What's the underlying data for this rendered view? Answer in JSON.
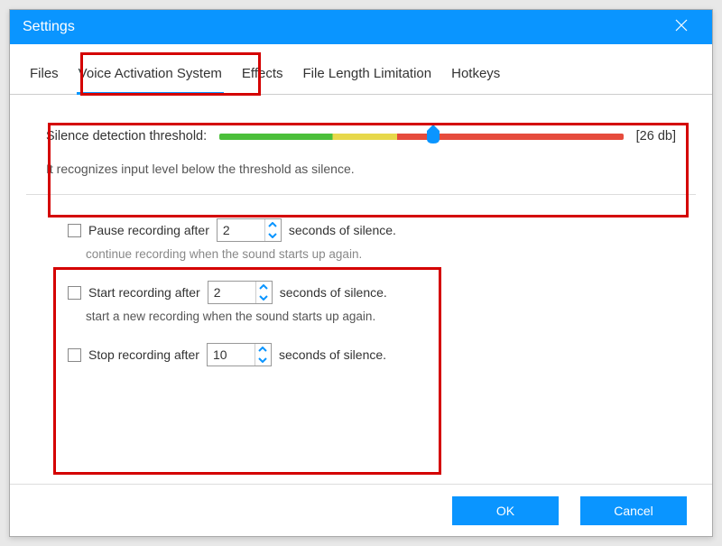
{
  "window": {
    "title": "Settings"
  },
  "tabs": {
    "items": [
      {
        "label": "Files"
      },
      {
        "label": "Voice Activation System"
      },
      {
        "label": "Effects"
      },
      {
        "label": "File Length Limitation"
      },
      {
        "label": "Hotkeys"
      }
    ],
    "active_index": 1
  },
  "threshold": {
    "label": "Silence detection threshold:",
    "value_text": "[26 db]",
    "percent": 53,
    "hint": "It recognizes input level below the threshold as silence."
  },
  "options": {
    "pause": {
      "label_before": "Pause recording after",
      "value": "2",
      "label_after": "seconds of silence.",
      "sub": "continue recording when the sound starts up again."
    },
    "start": {
      "label_before": "Start recording after",
      "value": "2",
      "label_after": "seconds of silence.",
      "sub": "start a new recording when the sound starts up again."
    },
    "stop": {
      "label_before": "Stop recording after",
      "value": "10",
      "label_after": "seconds of silence."
    }
  },
  "footer": {
    "ok": "OK",
    "cancel": "Cancel"
  }
}
